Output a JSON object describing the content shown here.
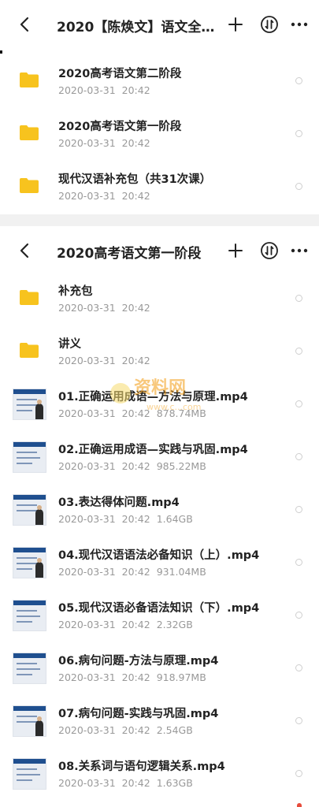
{
  "panel1": {
    "title": "2020【陈焕文】语文全…",
    "items": [
      {
        "name": "2020高考语文第二阶段",
        "date": "2020-03-31",
        "time": "20:42",
        "size": ""
      },
      {
        "name": "2020高考语文第一阶段",
        "date": "2020-03-31",
        "time": "20:42",
        "size": ""
      },
      {
        "name": "现代汉语补充包（共31次课）",
        "date": "2020-03-31",
        "time": "20:42",
        "size": ""
      }
    ]
  },
  "panel2": {
    "title": "2020高考语文第一阶段",
    "items": [
      {
        "name": "补充包",
        "date": "2020-03-31",
        "time": "20:42",
        "size": "",
        "kind": "folder"
      },
      {
        "name": "讲义",
        "date": "2020-03-31",
        "time": "20:42",
        "size": "",
        "kind": "folder"
      },
      {
        "name": "01.正确运用成语—方法与原理.mp4",
        "date": "2020-03-31",
        "time": "20:42",
        "size": "878.74MB",
        "kind": "video"
      },
      {
        "name": "02.正确运用成语—实践与巩固.mp4",
        "date": "2020-03-31",
        "time": "20:42",
        "size": "985.22MB",
        "kind": "video"
      },
      {
        "name": "03.表达得体问题.mp4",
        "date": "2020-03-31",
        "time": "20:42",
        "size": "1.64GB",
        "kind": "video"
      },
      {
        "name": "04.现代汉语语法必备知识（上）.mp4",
        "date": "2020-03-31",
        "time": "20:42",
        "size": "931.04MB",
        "kind": "video"
      },
      {
        "name": "05.现代汉语必备语法知识（下）.mp4",
        "date": "2020-03-31",
        "time": "20:42",
        "size": "2.32GB",
        "kind": "video"
      },
      {
        "name": "06.病句问题-方法与原理.mp4",
        "date": "2020-03-31",
        "time": "20:42",
        "size": "918.97MB",
        "kind": "video"
      },
      {
        "name": "07.病句问题-实践与巩固.mp4",
        "date": "2020-03-31",
        "time": "20:42",
        "size": "2.54GB",
        "kind": "video"
      },
      {
        "name": "08.关系词与语句逻辑关系.mp4",
        "date": "2020-03-31",
        "time": "20:42",
        "size": "1.63GB",
        "kind": "video"
      }
    ]
  },
  "watermark": {
    "text": "资料网",
    "sub": "www.c...com"
  },
  "colors": {
    "folder": "#F7C31E",
    "title": "#222222",
    "meta": "#999999",
    "band": "#F1F1F1"
  },
  "icons": {
    "back": "back-arrow-icon",
    "add": "plus-icon",
    "sort": "sort-icon",
    "more": "more-icon",
    "folder": "folder-icon"
  }
}
